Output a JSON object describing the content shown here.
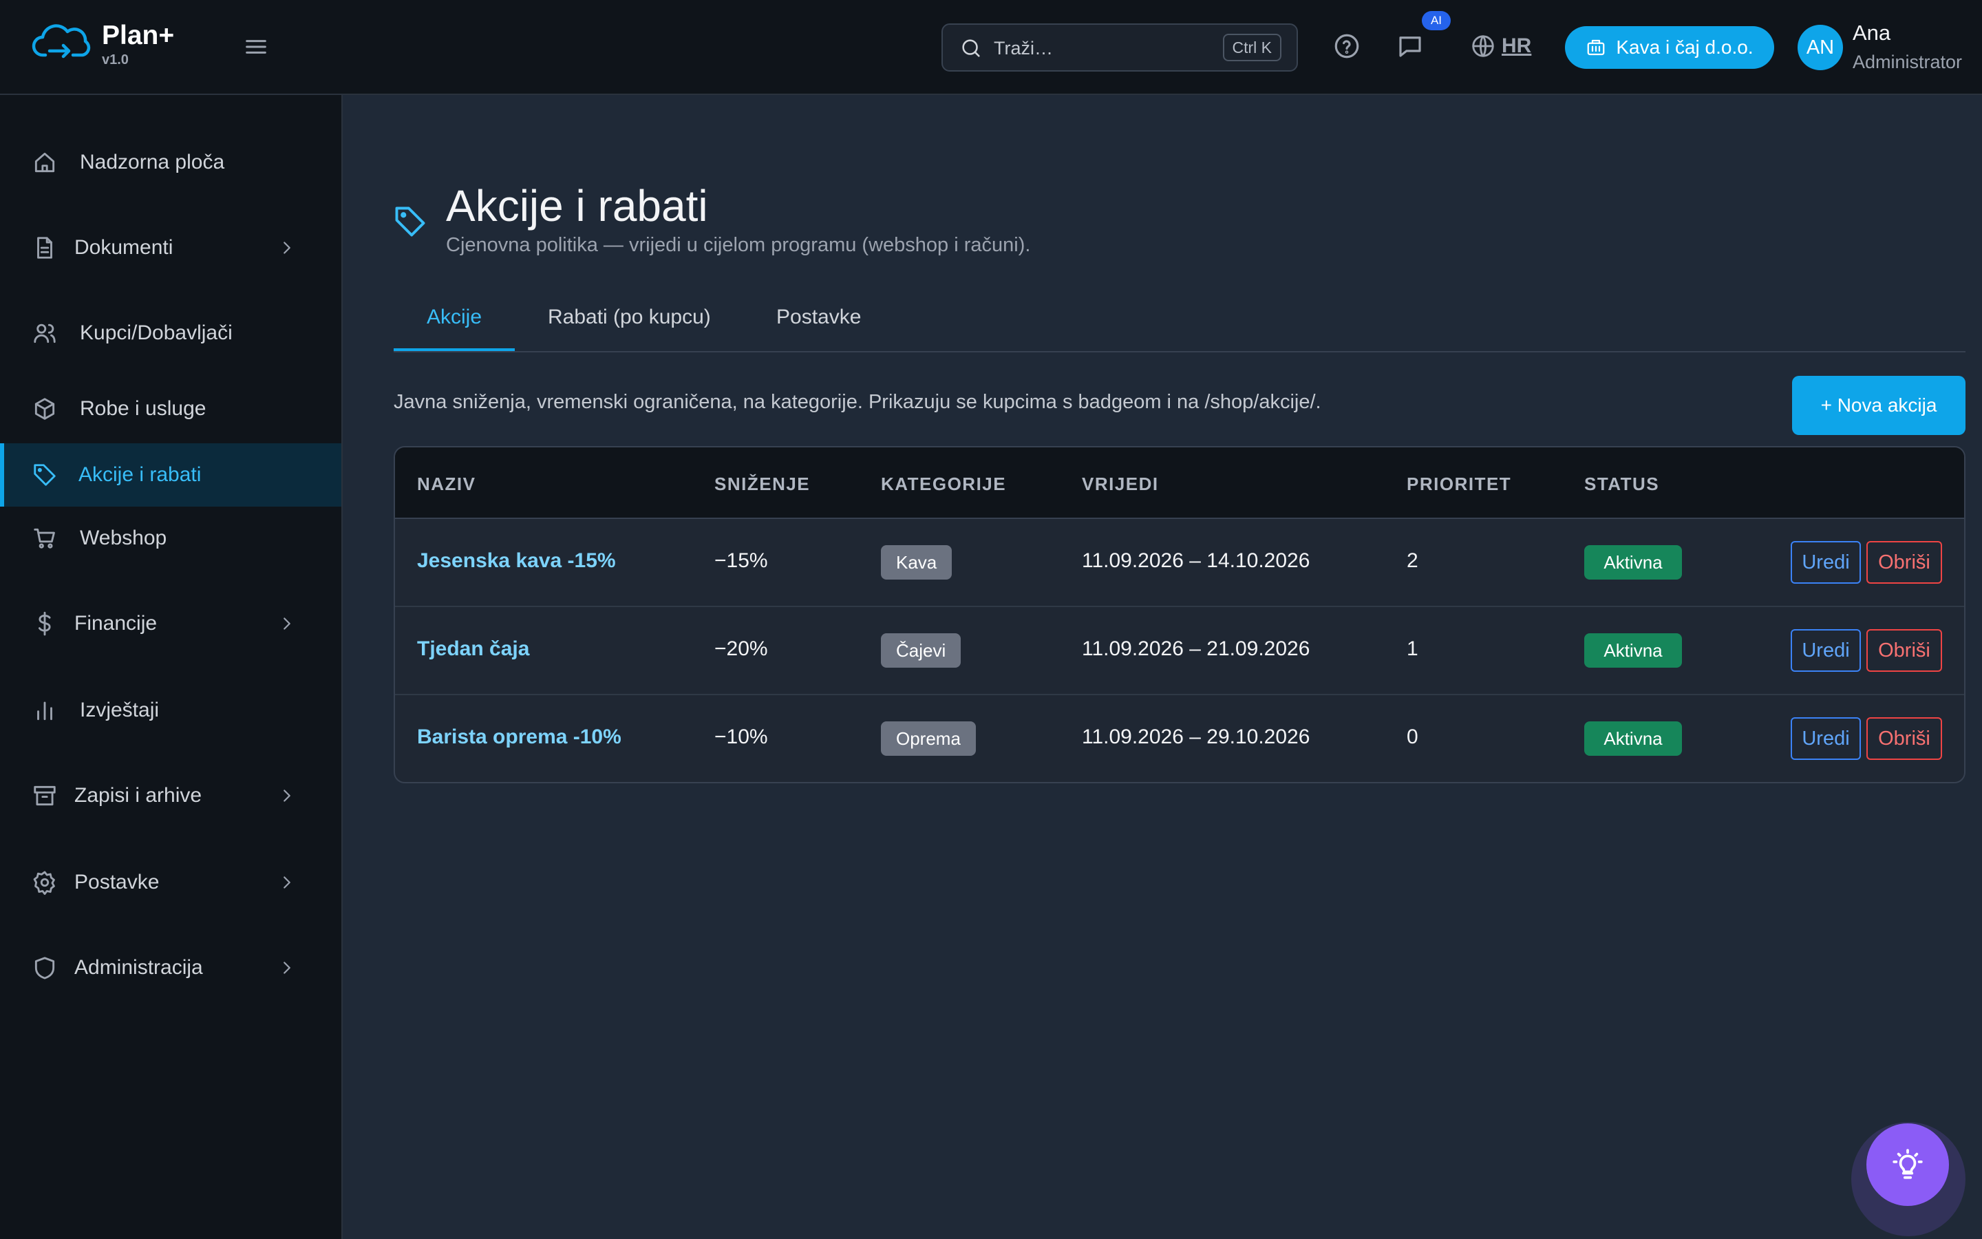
{
  "header": {
    "brand_name": "Plan+",
    "brand_version": "v1.0",
    "search_placeholder": "Traži…",
    "search_shortcut": "Ctrl K",
    "ai_badge": "AI",
    "language": "HR",
    "company": "Kava i čaj d.o.o.",
    "user": {
      "initials": "AN",
      "name": "Ana",
      "role": "Administrator"
    }
  },
  "sidebar": {
    "items": [
      {
        "label": "Nadzorna ploča",
        "icon": "home-icon",
        "has_children": false
      },
      {
        "label": "Dokumenti",
        "icon": "document-icon",
        "has_children": true
      },
      {
        "label": "Kupci/Dobavljači",
        "icon": "users-icon",
        "has_children": false
      },
      {
        "label": "Robe i usluge",
        "icon": "box-icon",
        "has_children": false
      },
      {
        "label": "Akcije i rabati",
        "icon": "tag-icon",
        "has_children": false,
        "active": true
      },
      {
        "label": "Webshop",
        "icon": "cart-icon",
        "has_children": false
      },
      {
        "label": "Financije",
        "icon": "dollar-icon",
        "has_children": true
      },
      {
        "label": "Izvještaji",
        "icon": "bar-chart-icon",
        "has_children": false
      },
      {
        "label": "Zapisi i arhive",
        "icon": "archive-icon",
        "has_children": true
      },
      {
        "label": "Postavke",
        "icon": "gear-icon",
        "has_children": true
      },
      {
        "label": "Administracija",
        "icon": "shield-icon",
        "has_children": true
      }
    ]
  },
  "main": {
    "title": "Akcije i rabati",
    "subtitle": "Cjenovna politika — vrijedi u cijelom programu (webshop i računi).",
    "tabs": [
      {
        "label": "Akcije",
        "active": true
      },
      {
        "label": "Rabati (po kupcu)",
        "active": false
      },
      {
        "label": "Postavke",
        "active": false
      }
    ],
    "intro": "Javna sniženja, vremenski ograničena, na kategorije. Prikazuju se kupcima s badgeom i na /shop/akcije/.",
    "new_button": "+ Nova akcija",
    "table": {
      "columns": [
        "NAZIV",
        "SNIŽENJE",
        "KATEGORIJE",
        "VRIJEDI",
        "PRIORITET",
        "STATUS"
      ],
      "edit_label": "Uredi",
      "delete_label": "Obriši",
      "rows": [
        {
          "name": "Jesenska kava -15%",
          "discount": "−15%",
          "category": "Kava",
          "valid": "11.09.2026 – 14.10.2026",
          "priority": "2",
          "status": "Aktivna"
        },
        {
          "name": "Tjedan čaja",
          "discount": "−20%",
          "category": "Čajevi",
          "valid": "11.09.2026 – 21.09.2026",
          "priority": "1",
          "status": "Aktivna"
        },
        {
          "name": "Barista oprema -10%",
          "discount": "−10%",
          "category": "Oprema",
          "valid": "11.09.2026 – 29.10.2026",
          "priority": "0",
          "status": "Aktivna"
        }
      ]
    }
  },
  "colors": {
    "accent": "#0ea5e9",
    "success": "#16865a",
    "danger": "#ef4444",
    "fab": "#8b5cf6"
  },
  "fab_icon": "lightbulb-icon"
}
